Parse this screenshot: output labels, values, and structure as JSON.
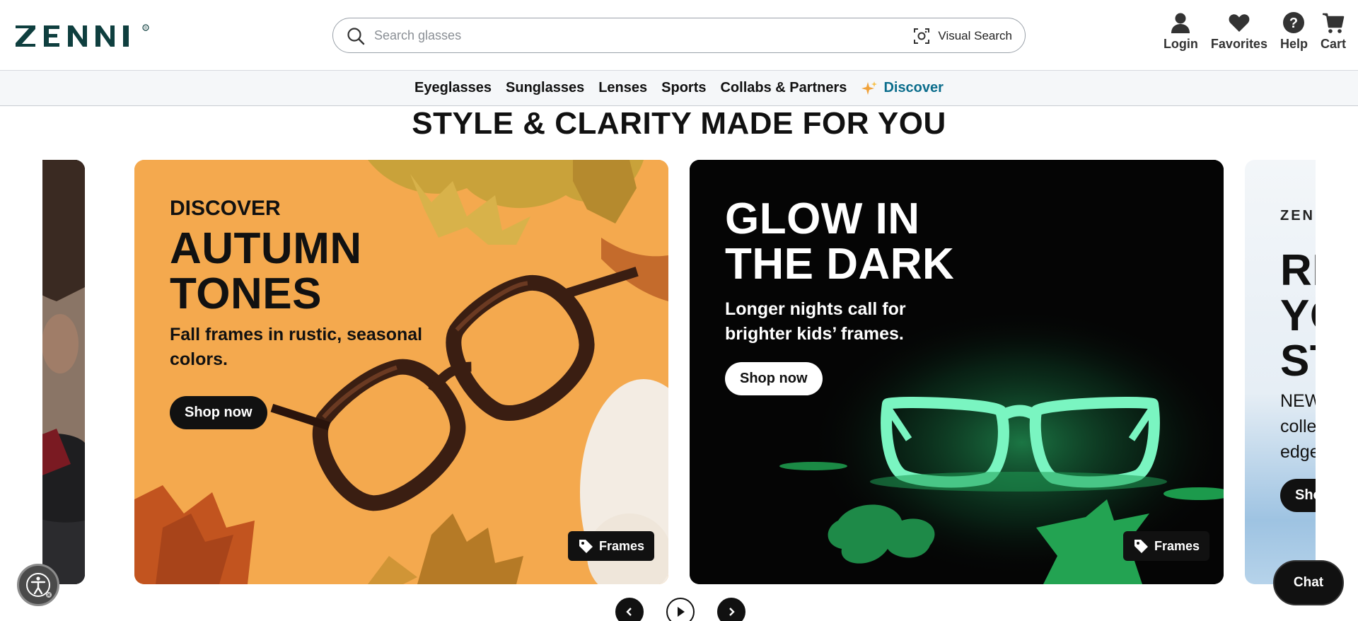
{
  "brand": {
    "logo_text": "ZENNI",
    "logo_mark": "®",
    "logo_color": "#0f3f3f"
  },
  "header": {
    "search_placeholder": "Search glasses",
    "visual_search_label": "Visual Search",
    "actions": [
      {
        "label": "Login",
        "icon": "user-icon"
      },
      {
        "label": "Favorites",
        "icon": "heart-icon"
      },
      {
        "label": "Help",
        "icon": "help-icon"
      },
      {
        "label": "Cart",
        "icon": "cart-icon"
      }
    ]
  },
  "nav": {
    "items": [
      "Eyeglasses",
      "Sunglasses",
      "Lenses",
      "Sports",
      "Collabs & Partners"
    ],
    "discover_label": "Discover",
    "discover_color": "#0b6d8c"
  },
  "hero": {
    "title": "STYLE & CLARITY MADE FOR YOU"
  },
  "cards": {
    "autumn": {
      "eyebrow": "DISCOVER",
      "title_line1": "AUTUMN",
      "title_line2": "TONES",
      "sub_line1": "Fall frames in rustic, seasonal",
      "sub_line2": "colors.",
      "button": "Shop now",
      "tag": "Frames",
      "bg_color": "#f4a94e"
    },
    "glow": {
      "title_line1": "GLOW IN",
      "title_line2": "THE DARK",
      "sub_line1": "Longer nights call for",
      "sub_line2": "brighter kids’ frames.",
      "button": "Shop now",
      "tag": "Frames",
      "accent_color": "#5cf0b0"
    },
    "next": {
      "brand": "ZENNI",
      "title_line1": "RE",
      "title_line2": "YO",
      "title_line3": "ST",
      "sub_line1": "NEW",
      "sub_line2": "colle",
      "sub_line3": "edge",
      "button": "Sho"
    }
  },
  "chat": {
    "label": "Chat"
  }
}
